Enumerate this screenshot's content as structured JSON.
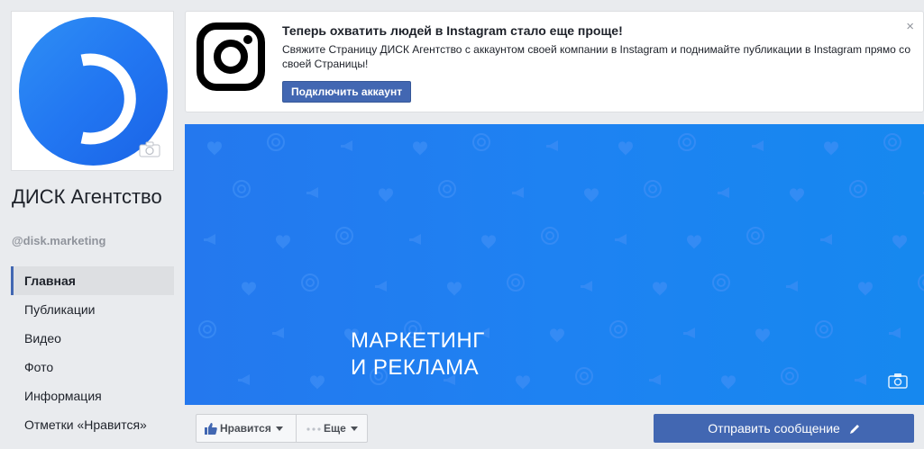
{
  "page": {
    "name": "ДИСК Агентство",
    "handle": "@disk.marketing"
  },
  "nav": {
    "items": [
      {
        "label": "Главная",
        "active": true
      },
      {
        "label": "Публикации"
      },
      {
        "label": "Видео"
      },
      {
        "label": "Фото"
      },
      {
        "label": "Информация"
      },
      {
        "label": "Отметки «Нравится»"
      }
    ]
  },
  "instagram": {
    "title": "Теперь охватить людей в Instagram стало еще проще!",
    "description": "Свяжите Страницу ДИСК Агентство с аккаунтом своей компании в Instagram и поднимайте публикации в Instagram прямо со своей Страницы!",
    "button": "Подключить аккаунт",
    "close": "×"
  },
  "cover": {
    "line1": "МАРКЕТИНГ",
    "line2": "И РЕКЛАМА"
  },
  "actions": {
    "like": "Нравится",
    "more": "Еще",
    "message": "Отправить сообщение"
  },
  "colors": {
    "accent": "#4267b2",
    "cover": "#1e82f2",
    "background": "#e9ebee"
  }
}
